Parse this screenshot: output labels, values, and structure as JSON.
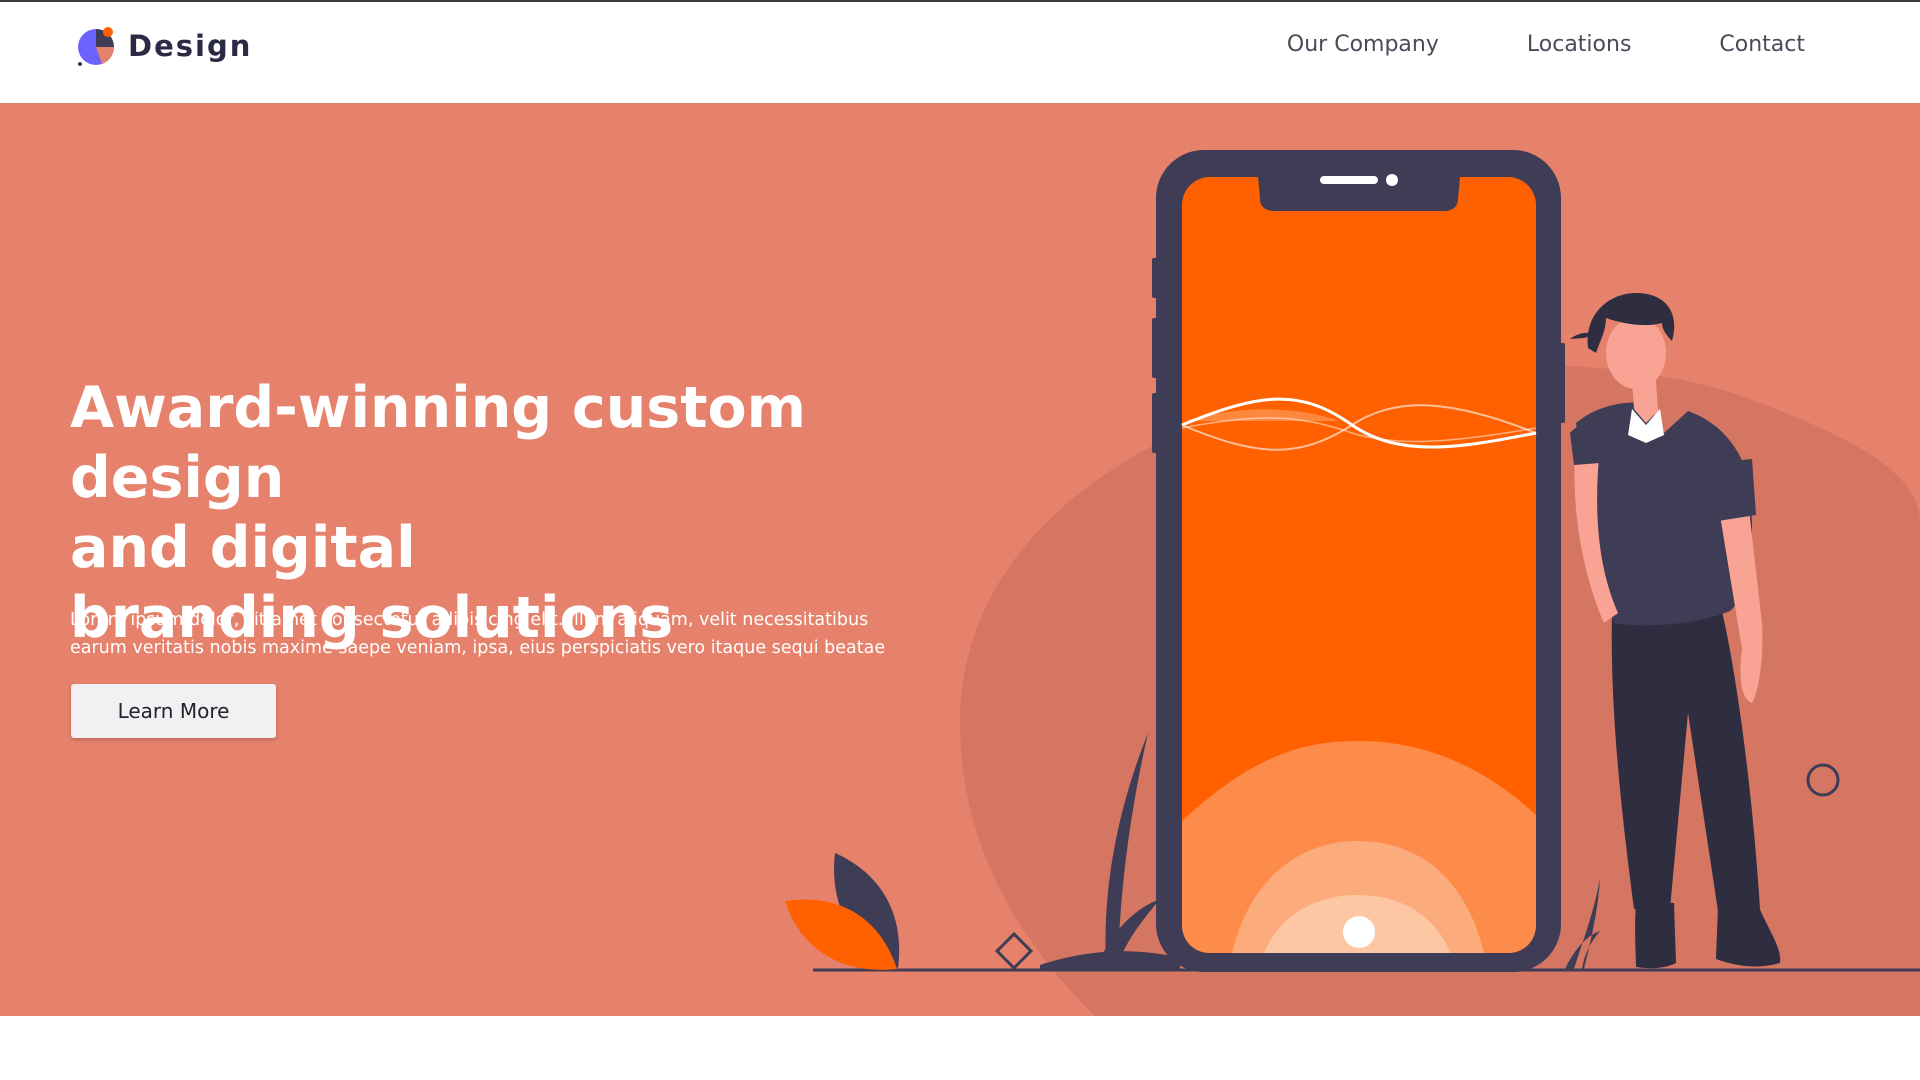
{
  "header": {
    "brand": "Design",
    "nav": {
      "our_company": "Our Company",
      "locations": "Locations",
      "contact": "Contact"
    }
  },
  "hero": {
    "headline_lines": [
      "Award-winning custom design",
      "and digital",
      "branding solutions"
    ],
    "subtext_line1": "Lorem ipsum dolor, sit amet consectetur adipisicing elit. Illum aliquam, velit necessitatibus",
    "subtext_line2": "earum veritatis nobis maxime saepe veniam, ipsa, eius perspiciatis vero itaque sequi beatae",
    "cta_label": "Learn More"
  },
  "colors": {
    "hero_background": "#e6816c",
    "phone_frame": "#3f3d56",
    "phone_screen": "#ff6100",
    "button_background": "#f1f1f1"
  },
  "icons": [
    "logo-mark-icon",
    "phone-illustration",
    "person-illustration",
    "plant-icon",
    "leaf-icon",
    "circle-outline-icon",
    "diamond-outline-icon"
  ]
}
